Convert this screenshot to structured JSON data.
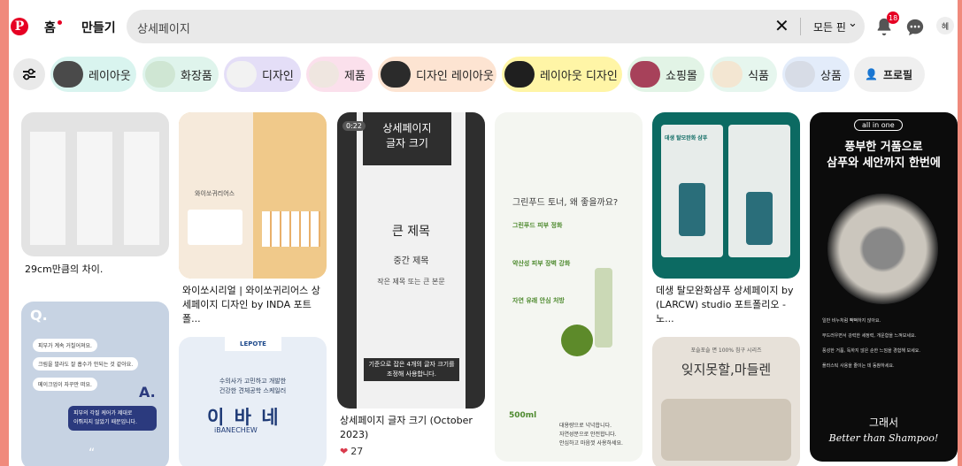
{
  "header": {
    "nav": {
      "home": "홈",
      "create": "만들기"
    },
    "search": {
      "query": "상세페이지",
      "filter": "모든 핀"
    },
    "notifications_badge": "18",
    "avatar": "혜"
  },
  "chips": [
    {
      "label": "레이아웃",
      "color": "#d9f4ef"
    },
    {
      "label": "화장품",
      "color": "#dff4ec"
    },
    {
      "label": "디자인",
      "color": "#e4def7"
    },
    {
      "label": "제품",
      "color": "#fbe0ec"
    },
    {
      "label": "디자인 레이아웃",
      "color": "#fde4d2"
    },
    {
      "label": "레이아웃 디자인",
      "color": "#fff5a6"
    },
    {
      "label": "쇼핑몰",
      "color": "#e2f4e6"
    },
    {
      "label": "식품",
      "color": "#e6f6ee"
    },
    {
      "label": "상품",
      "color": "#e3ecfa"
    }
  ],
  "profile_chip": "프로필",
  "pins": {
    "p1": {
      "title": "29cm만큼의 차이."
    },
    "p2": {
      "title": "와이쏘시리얼 | 와이쏘귀리어스 상세페이지 디자인 by INDA 포트폴...",
      "img_text": "와이쏘귀리어스"
    },
    "p3": {
      "duration": "0:22",
      "img_head": "상세페이지\n글자 크기",
      "img_big": "큰 제목",
      "img_mid": "중간 제목",
      "img_small": "작은 제목 또는 큰 본문",
      "img_caption": "기준으로 잡은 4개의 글자 크기를\n조정해 사용합니다.",
      "title": "상세페이지 글자 크기 (October 2023)",
      "likes": "27"
    },
    "p4": {
      "img_head": "그린푸드 토너, 왜 좋을까요?",
      "items": [
        "그린푸드 피부 정화",
        "약산성 피부 장벽 강화",
        "자연 유래 안심 처방"
      ],
      "img_vol": "500ml",
      "img_foot": "대용량으로 넉넉합니다.\n자연성분으로 안전합니다.\n안심하고 마음껏 사용하세요."
    },
    "p5": {
      "title": "데생 탈모완화샴푸 상세페이지 by (LARCW) studio 포트폴리오 - 노...",
      "img_text": "데생 탈모완화 샴푸"
    },
    "p6": {
      "badge": "all in one",
      "img_head": "풍부한 거품으로\n삼푸와 세안까지 한번에",
      "checks": [
        "일반 비누처럼 뻑뻑하지 않아요.",
        "부드러우면서 강력한 세정력, 개운함을 느껴보세요.",
        "풍성한 거품, 독하지 않은 순한 느낌을 경험해 보세요.",
        "플라스틱 사용을 줄이는 데 동참하세요."
      ],
      "img_foot": "그래서",
      "img_foot2": "Better than Shampoo!"
    },
    "p7": {
      "q": "Q.",
      "bubbles": [
        "피부가 계속 거칠어져요.",
        "크림을 발라도 잘 흡수가 안되는 것 같아요.",
        "메이크업이 자꾸만 떠요."
      ],
      "a": "A.",
      "answer": "피부의 각질 케어가 제대로\n이뤄지지 않았기 때문입니다.",
      "quote": "“"
    },
    "p8": {
      "brand": "LEPOTE",
      "line": "수의사가 고민하고 개발한\n건강한 견체공학 스케일러",
      "name": "이 바 네",
      "name_en": "iBANECHEW"
    },
    "p9": {
      "small": "포슬포슬 면 100% 침구 시리즈",
      "big": "잊지못할,마들렌"
    }
  }
}
